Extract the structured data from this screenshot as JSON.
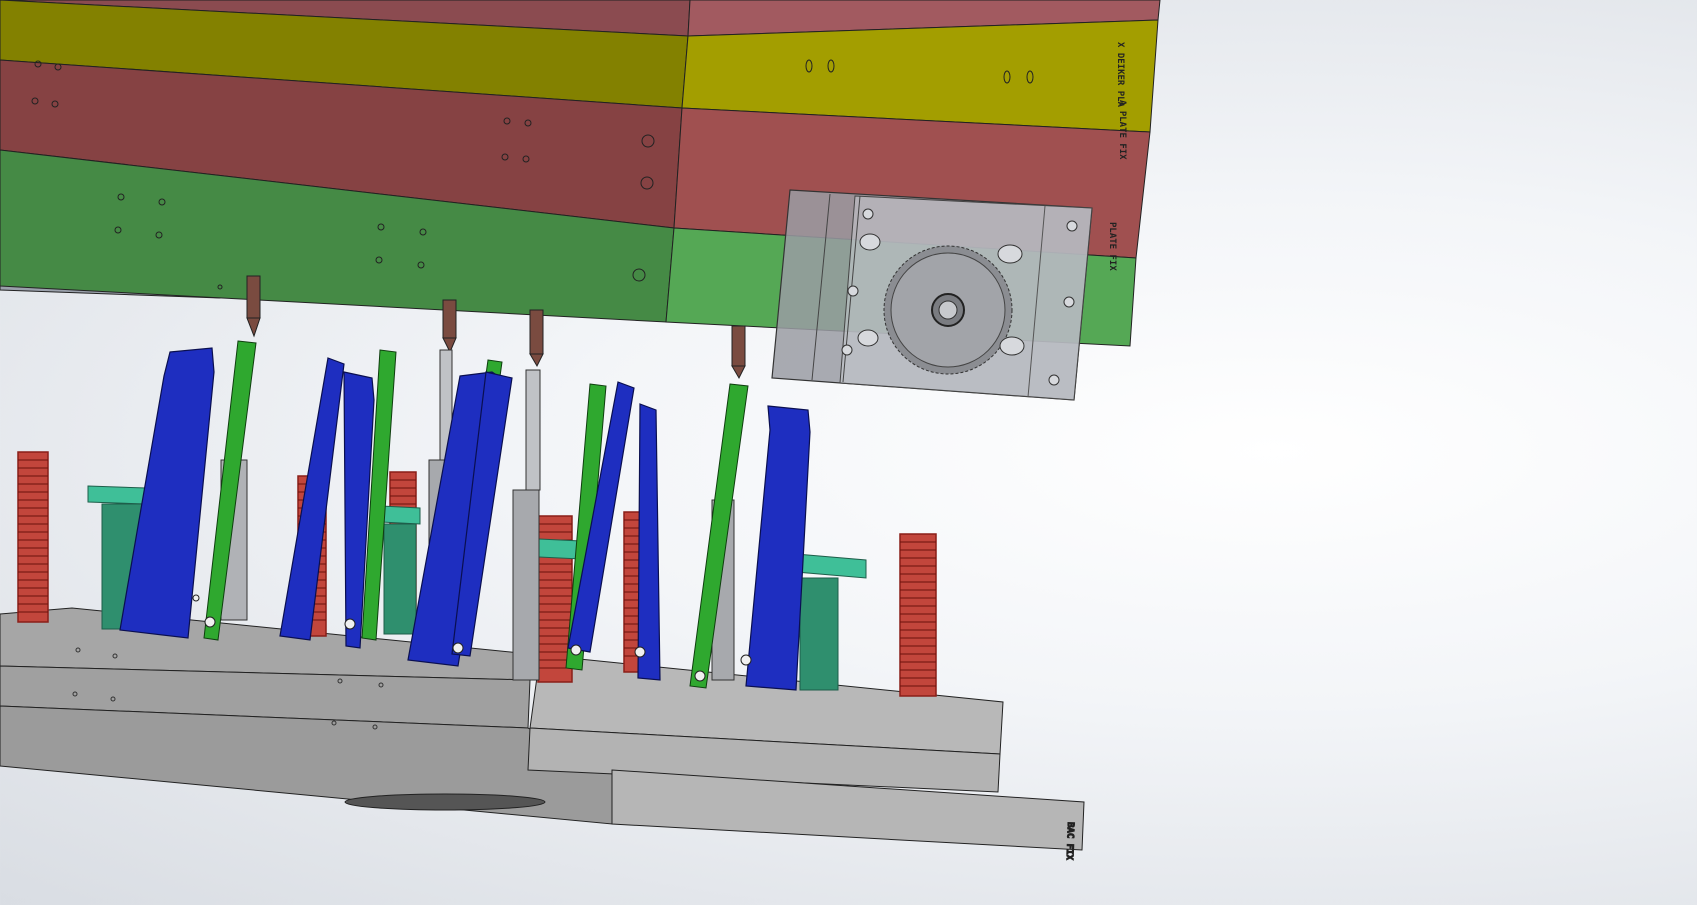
{
  "viewport": {
    "label": "3D CAD model viewport"
  },
  "engravings": {
    "top_plate_1": "X DEIKER PLA",
    "top_plate_2": "A PLATE FIX",
    "top_plate_3": "PLATE FIX",
    "bottom_plate": "BAC FIX"
  },
  "colors": {
    "top_clamp_plate": "#9a5257",
    "stripper_plate_yellow": "#8f8a00",
    "cavity_plate_red": "#8a4646",
    "core_plate_green": "#4e9a4e",
    "lifter_blue": "#1f2fc2",
    "slide_green": "#27a027",
    "spring_red": "#b5332a",
    "guide_teal": "#37b08c",
    "base_plate_gray": "#a8a8a8",
    "gearbox_gray": "#9ea0a6"
  }
}
